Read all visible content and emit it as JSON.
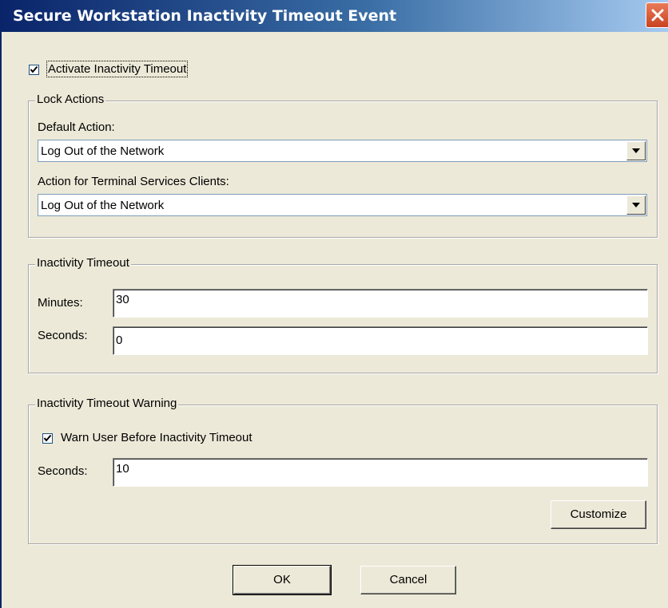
{
  "window": {
    "title": "Secure Workstation Inactivity Timeout Event"
  },
  "activate": {
    "label": "Activate Inactivity Timeout",
    "checked": true
  },
  "lock_actions": {
    "group_title": "Lock Actions",
    "default_action_label": "Default Action:",
    "default_action_value": "Log Out of the Network",
    "terminal_action_label": "Action for Terminal Services Clients:",
    "terminal_action_value": "Log Out of the Network"
  },
  "inactivity_timeout": {
    "group_title": "Inactivity Timeout",
    "minutes_label": "Minutes:",
    "minutes_value": "30",
    "seconds_label": "Seconds:",
    "seconds_value": "0"
  },
  "warning": {
    "group_title": "Inactivity Timeout Warning",
    "warn_label": "Warn User Before Inactivity Timeout",
    "warn_checked": true,
    "seconds_label": "Seconds:",
    "seconds_value": "10",
    "customize_label": "Customize"
  },
  "footer": {
    "ok_label": "OK",
    "cancel_label": "Cancel"
  }
}
